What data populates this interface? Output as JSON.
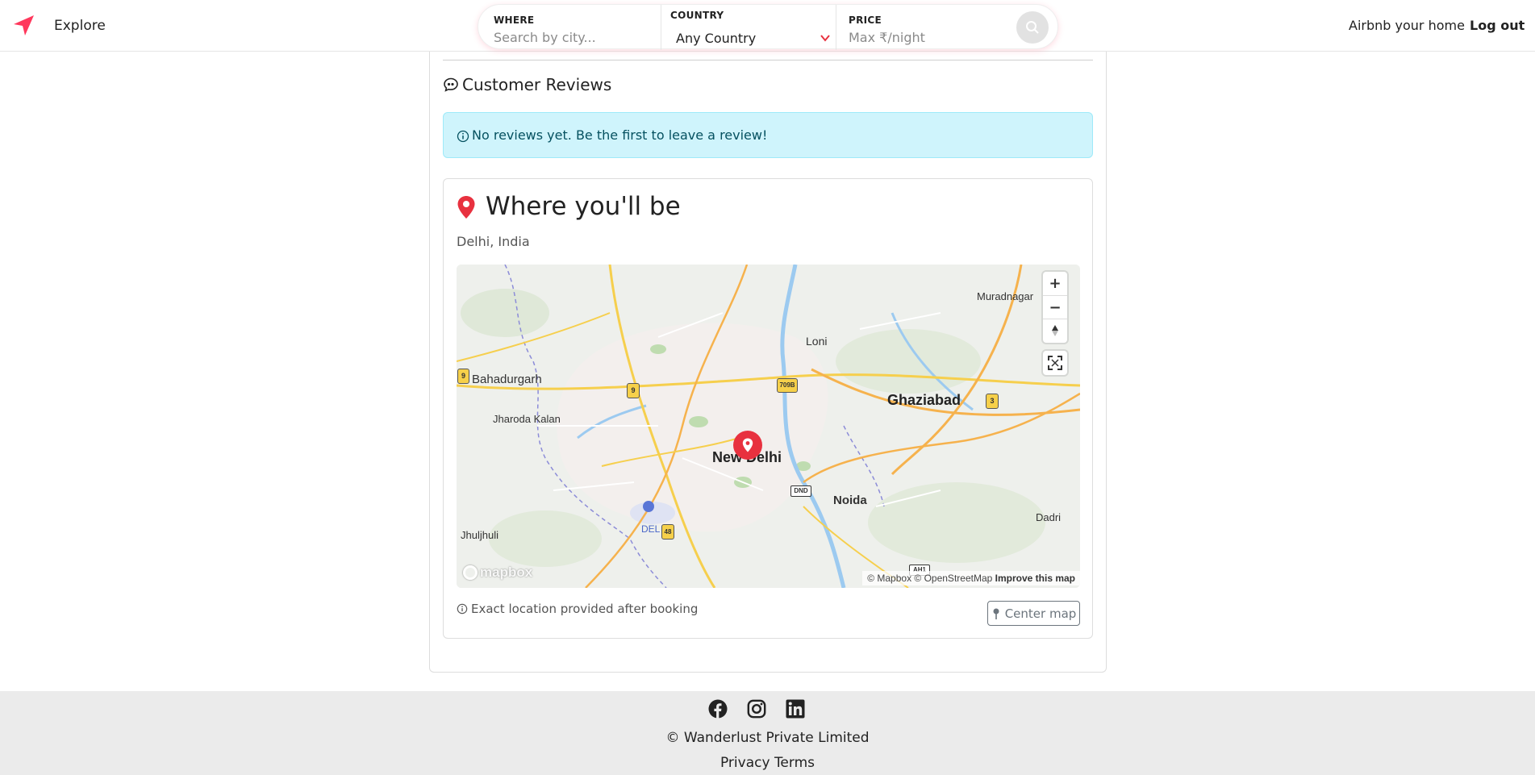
{
  "navbar": {
    "brand_icon": "compass-arrow-icon",
    "explore_label": "Explore",
    "search": {
      "where_label": "WHERE",
      "where_placeholder": "Search by city...",
      "country_label": "COUNTRY",
      "country_value": "Any Country",
      "price_label": "PRICE",
      "price_placeholder": "Max ₹/night",
      "search_icon": "search-icon"
    },
    "host_label": "Airbnb your home",
    "logout_label": "Log out"
  },
  "reviews": {
    "heading": "Customer Reviews",
    "heading_icon": "chat-quote-icon",
    "empty_message": "No reviews yet. Be the first to leave a review!"
  },
  "location": {
    "title": "Where you'll be",
    "subtitle": "Delhi, India",
    "note": "Exact location provided after booking",
    "center_button_label": "Center map"
  },
  "map": {
    "labels": {
      "muradnagar": "Muradnagar",
      "loni": "Loni",
      "bahadurgarh": "Bahadurgarh",
      "ghaziabad": "Ghaziabad",
      "jharoda_kalan": "Jharoda Kalan",
      "new_delhi": "New Delhi",
      "noida": "Noida",
      "dadri": "Dadri",
      "jhuljhuli": "Jhuljhuli",
      "del": "DEL"
    },
    "shields": {
      "s9a": "9",
      "s9b": "9",
      "s709b": "709B",
      "s3": "3",
      "sdnd": "DND",
      "s48": "48",
      "sah1": "AH1"
    },
    "controls": {
      "zoom_in": "+",
      "zoom_out": "−"
    },
    "logo": "mapbox",
    "attribution": "© Mapbox © OpenStreetMap",
    "improve_link": "Improve this map"
  },
  "footer": {
    "social_icons": [
      "facebook-icon",
      "instagram-icon",
      "linkedin-icon"
    ],
    "copyright": "© Wanderlust Private Limited",
    "links": "Privacy Terms"
  },
  "colors": {
    "brand": "#ff385c",
    "marker": "#e8313f",
    "alert_bg": "#cff4fc",
    "footer_bg": "#ebebeb"
  }
}
